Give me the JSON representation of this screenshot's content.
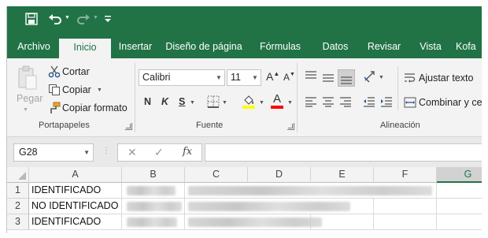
{
  "quick_access": {
    "icons": [
      "save-icon",
      "undo-icon",
      "redo-icon",
      "customize-icon"
    ],
    "accent": "#217346"
  },
  "tabs": [
    {
      "label": "Archivo"
    },
    {
      "label": "Inicio",
      "active": true
    },
    {
      "label": "Insertar"
    },
    {
      "label": "Diseño de página"
    },
    {
      "label": "Fórmulas"
    },
    {
      "label": "Datos"
    },
    {
      "label": "Revisar"
    },
    {
      "label": "Vista"
    },
    {
      "label": "Kofa"
    }
  ],
  "clipboard": {
    "paste_label": "Pegar",
    "cut_label": "Cortar",
    "copy_label": "Copiar",
    "format_painter_label": "Copiar formato",
    "group_label": "Portapapeles"
  },
  "font": {
    "font_name": "Calibri",
    "font_size": "11",
    "bold_label": "N",
    "italic_label": "K",
    "underline_label": "S",
    "group_label": "Fuente",
    "highlight_color": "#ffff00",
    "font_color": "#ff0000"
  },
  "alignment": {
    "wrap_text_label": "Ajustar texto",
    "merge_label": "Combinar y ce",
    "group_label": "Alineación"
  },
  "formula_bar": {
    "name_box": "G28",
    "cancel_glyph": "✕",
    "enter_glyph": "✓",
    "fx_label": "fx",
    "formula": ""
  },
  "sheet": {
    "columns": [
      "A",
      "B",
      "C",
      "D",
      "E",
      "F",
      "G"
    ],
    "selected_column": "G",
    "rows": [
      {
        "num": "1",
        "a": "IDENTIFICADO"
      },
      {
        "num": "2",
        "a": "NO  IDENTIFICADO"
      },
      {
        "num": "3",
        "a": "IDENTIFICADO"
      }
    ]
  }
}
